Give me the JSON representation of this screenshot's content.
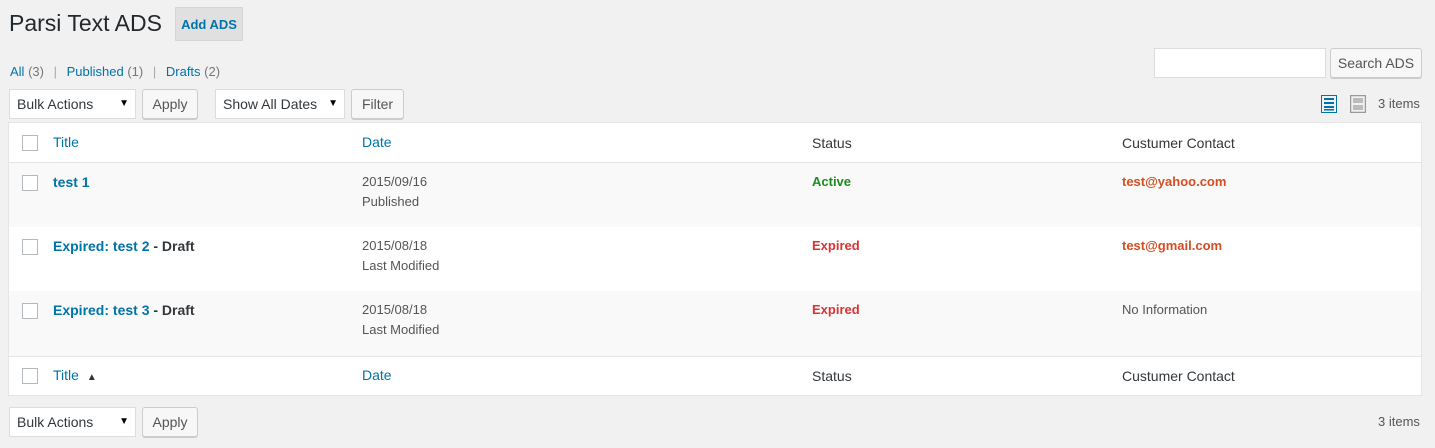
{
  "header": {
    "title": "Parsi Text ADS",
    "add_button": "Add ADS"
  },
  "views": {
    "all": {
      "label": "All",
      "count": "(3)"
    },
    "published": {
      "label": "Published",
      "count": "(1)"
    },
    "drafts": {
      "label": "Drafts",
      "count": "(2)"
    },
    "separator": "|"
  },
  "search": {
    "button": "Search ADS",
    "value": ""
  },
  "top_nav": {
    "bulk_actions": "Bulk Actions",
    "apply": "Apply",
    "dates": "Show All Dates",
    "filter": "Filter",
    "items": "3 items",
    "view_icons": [
      "list-view-icon",
      "excerpt-view-icon"
    ]
  },
  "columns": {
    "title": "Title",
    "date": "Date",
    "status": "Status",
    "contact": "Custumer Contact",
    "sort_indicator": "▲"
  },
  "rows": [
    {
      "title": "test 1",
      "suffix": "",
      "date": "2015/09/16",
      "date_label": "Published",
      "status": "Active",
      "status_color": "#1e8a1e",
      "contact": "test@yahoo.com"
    },
    {
      "title": "Expired: test 2",
      "suffix": " - Draft",
      "date": "2015/08/18",
      "date_label": "Last Modified",
      "status": "Expired",
      "status_color": "#dc3232",
      "contact": "test@gmail.com"
    },
    {
      "title": "Expired: test 3",
      "suffix": " - Draft",
      "date": "2015/08/18",
      "date_label": "Last Modified",
      "status": "Expired",
      "status_color": "#dc3232",
      "contact": "No Information"
    }
  ],
  "bottom_nav": {
    "bulk_actions": "Bulk Actions",
    "apply": "Apply",
    "items": "3 items"
  },
  "colors": {
    "link": "#0073aa",
    "active": "#1e8a1e",
    "expired": "#dc3232",
    "contact": "#d54e21"
  }
}
